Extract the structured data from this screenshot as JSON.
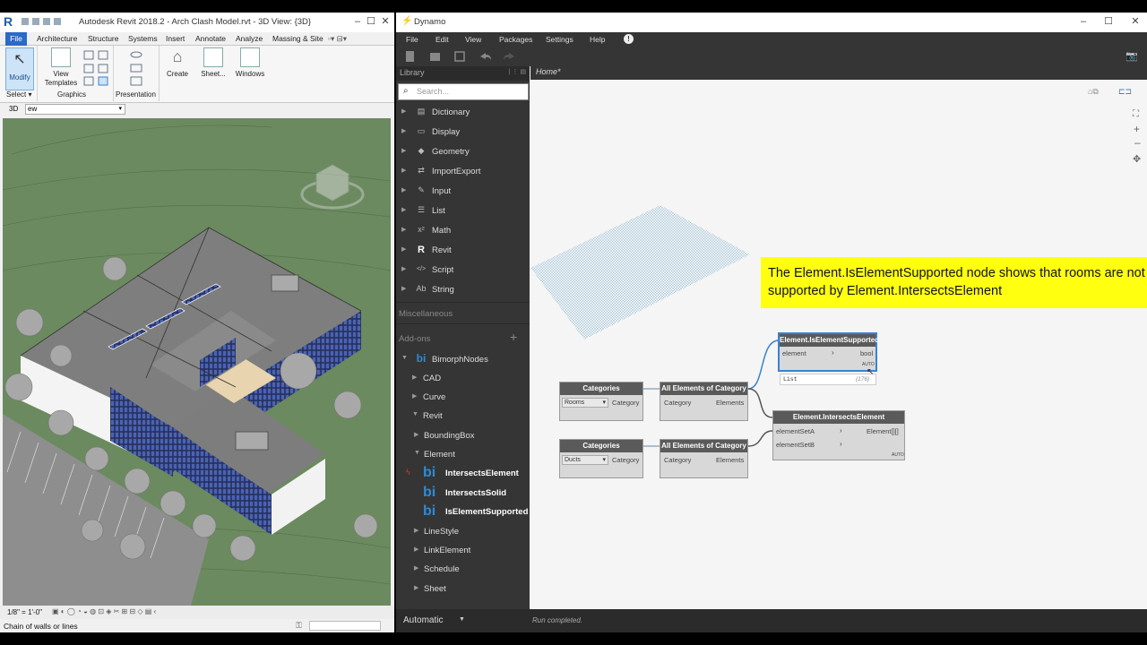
{
  "revit": {
    "logo": "R",
    "title": "Autodesk Revit 2018.2 -     Arch Clash Model.rvt - 3D View: {3D}",
    "file_tab": "File",
    "tabs": [
      "Architecture",
      "Structure",
      "Systems",
      "Insert",
      "Annotate",
      "Analyze",
      "Massing & Site"
    ],
    "ribbon_buttons": {
      "modify": "Modify",
      "view_templates": "View Templates",
      "create": "Create",
      "sheet": "Sheet...",
      "windows": "Windows"
    },
    "ribbon_groups": {
      "select": "Select ▾",
      "graphics": "Graphics",
      "presentation": "Presentation"
    },
    "view_prefix": "3D",
    "view_name": "ew",
    "scale": "1/8\" = 1'-0\"",
    "status": "Chain of walls or lines"
  },
  "dynamo": {
    "title": "Dynamo",
    "menu": [
      "File",
      "Edit",
      "View",
      "Packages",
      "Settings",
      "Help"
    ],
    "library_title": "Library",
    "search_placeholder": "Search...",
    "library_items": [
      {
        "icon": "▤",
        "label": "Dictionary"
      },
      {
        "icon": "▭",
        "label": "Display"
      },
      {
        "icon": "◆",
        "label": "Geometry"
      },
      {
        "icon": "⇄",
        "label": "ImportExport"
      },
      {
        "icon": "✎",
        "label": "Input"
      },
      {
        "icon": "☰",
        "label": "List"
      },
      {
        "icon": "x²",
        "label": "Math"
      },
      {
        "icon": "R",
        "label": "Revit"
      },
      {
        "icon": "</>",
        "label": "Script"
      },
      {
        "icon": "Ab",
        "label": "String"
      }
    ],
    "misc": "Miscellaneous",
    "addons": "Add-ons",
    "addon_plus": "+",
    "package": "BimorphNodes",
    "package_tree": [
      "CAD",
      "Curve",
      "Revit",
      "BoundingBox",
      "Element"
    ],
    "package_leaves": [
      "IntersectsElement",
      "IntersectsSolid",
      "IsElementSupported"
    ],
    "package_tree_tail": [
      "LineStyle",
      "LinkElement",
      "Schedule",
      "Sheet"
    ],
    "tab": "Home*",
    "note": "The Element.IsElementSupported node shows that rooms are not supported by Element.IntersectsElement",
    "nodes": {
      "categories1": {
        "title": "Categories",
        "dropdown": "Rooms",
        "out": "Category"
      },
      "categories2": {
        "title": "Categories",
        "dropdown": "Ducts",
        "out": "Category"
      },
      "allelements1": {
        "title": "All Elements of Category",
        "in": "Category",
        "out": "Elements"
      },
      "allelements2": {
        "title": "All Elements of Category",
        "in": "Category",
        "out": "Elements"
      },
      "supported": {
        "title": "Element.IsElementSupported",
        "in": "element",
        "out": "bool",
        "lacing": "AUTO",
        "preview": "List",
        "preview_count": "{176}"
      },
      "intersects": {
        "title": "Element.IntersectsElement",
        "in_a": "elementSetA",
        "in_b": "elementSetB",
        "out": "Element[][]",
        "lacing": "AUTO"
      }
    },
    "run_mode": "Automatic",
    "run_status": "Run completed."
  }
}
